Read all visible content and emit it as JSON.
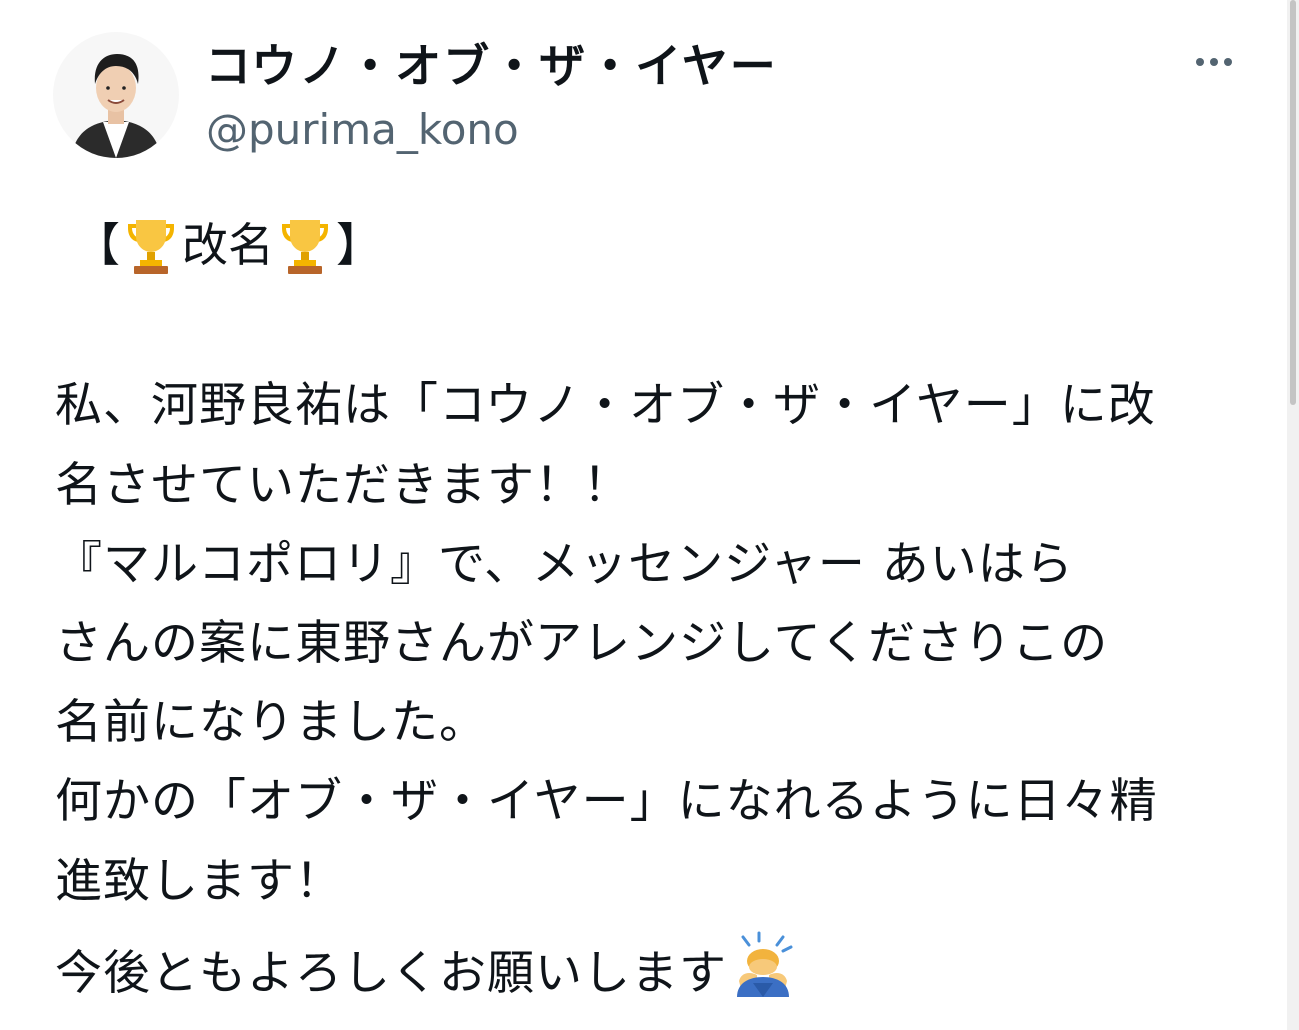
{
  "author": {
    "display_name": "コウノ・オブ・ザ・イヤー",
    "handle": "@purima_kono"
  },
  "tweet": {
    "headline_open": "【",
    "headline_text": "改名",
    "headline_close": "】",
    "lines": [
      "私、河野良祐は「コウノ・オブ・ザ・イヤー」に改",
      "名させていただきます！！",
      "『マルコポロリ』で、メッセンジャー あいはら",
      "さんの案に東野さんがアレンジしてくださりこの",
      "名前になりました。",
      "何かの「オブ・ザ・イヤー」になれるように日々精",
      "進致します！",
      "今後ともよろしくお願いします"
    ]
  },
  "icons": {
    "more": "more-options-icon",
    "trophy": "trophy-emoji-icon",
    "bow": "person-bowing-emoji-icon"
  },
  "colors": {
    "text": "#0f1419",
    "secondary": "#536471",
    "trophy_gold": "#f4b400",
    "trophy_base": "#b8652a"
  }
}
